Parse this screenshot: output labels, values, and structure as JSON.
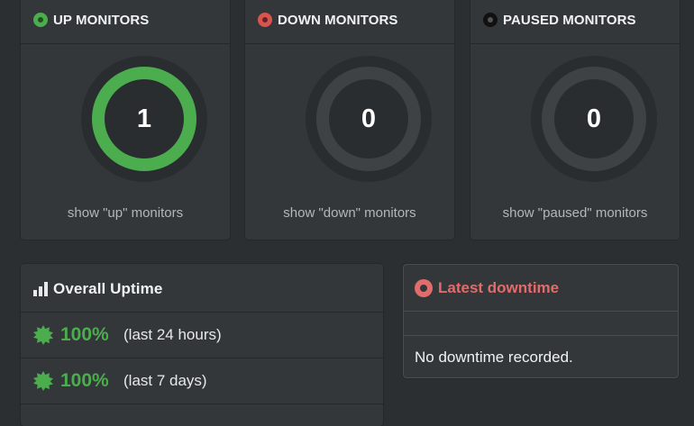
{
  "monitors": {
    "up": {
      "title": "UP MONITORS",
      "count": "1",
      "link": "show \"up\" monitors",
      "color": "#4cad4f",
      "icon": "green-status-dot-icon"
    },
    "down": {
      "title": "DOWN MONITORS",
      "count": "0",
      "link": "show \"down\" monitors",
      "color": "#d9534f",
      "icon": "red-status-dot-icon"
    },
    "paused": {
      "title": "PAUSED MONITORS",
      "count": "0",
      "link": "show \"paused\" monitors",
      "color": "#111111",
      "icon": "black-status-dot-icon"
    }
  },
  "uptime": {
    "title": "Overall Uptime",
    "icon": "bar-chart-icon",
    "rows": [
      {
        "percent": "100%",
        "period": "(last 24 hours)",
        "icon": "burst-icon"
      },
      {
        "percent": "100%",
        "period": "(last 7 days)",
        "icon": "burst-icon"
      }
    ],
    "accent": "#4cad4f"
  },
  "downtime": {
    "title": "Latest downtime",
    "icon": "red-circle-icon",
    "message": "No downtime recorded.",
    "accent": "#e06c6c"
  }
}
